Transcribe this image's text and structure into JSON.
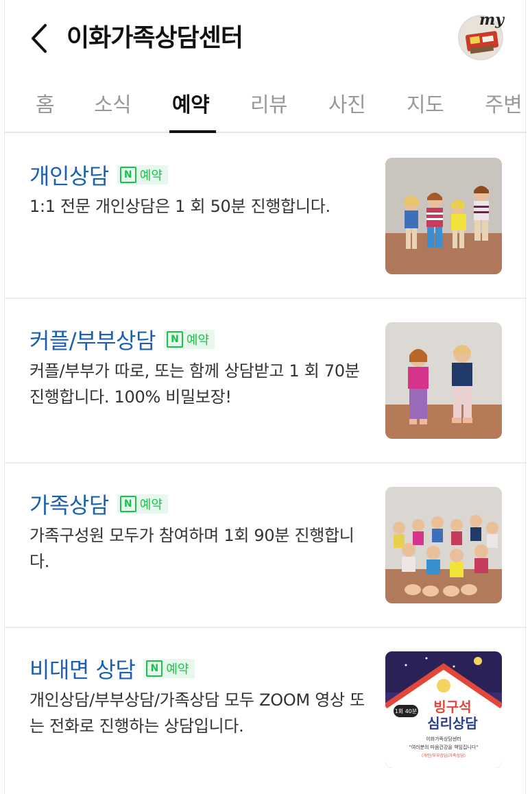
{
  "header": {
    "title": "이화가족상담센터",
    "my_label": "my"
  },
  "tabs": [
    {
      "label": "홈"
    },
    {
      "label": "소식"
    },
    {
      "label": "예약",
      "active": true
    },
    {
      "label": "리뷰"
    },
    {
      "label": "사진"
    },
    {
      "label": "지도"
    },
    {
      "label": "주변"
    }
  ],
  "items": [
    {
      "title": "개인상담",
      "badge": "예약",
      "description": "1:1 전문 개인상담은 1 회 50분 진행합니다."
    },
    {
      "title": "커플/부부상담",
      "badge": "예약",
      "description": "커플/부부가 따로, 또는 함께 상담받고 1 회 70분 진행합니다. 100% 비밀보장!"
    },
    {
      "title": "가족상담",
      "badge": "예약",
      "description": "가족구성원 모두가 참여하며 1회 90분 진행합니다."
    },
    {
      "title": "비대면 상담",
      "badge": "예약",
      "description": "개인상담/부부상담/가족상담 모두 ZOOM 영상 또는 전화로 진행하는 상담입니다."
    }
  ],
  "poster": {
    "title_top": "빙구석",
    "title_bottom": "심리상담",
    "tag": "1회 40분",
    "line1": "이화가족상담센터",
    "line2": "\"여러분의 마음건강을 책임집니다\"",
    "line3": "(개인/부부상담/가족상담)"
  },
  "colors": {
    "accent_blue": "#1a5fb4",
    "naver_green": "#19c24a"
  },
  "icons": {
    "back": "chevron-left-icon",
    "badge": "naver-n-icon"
  }
}
